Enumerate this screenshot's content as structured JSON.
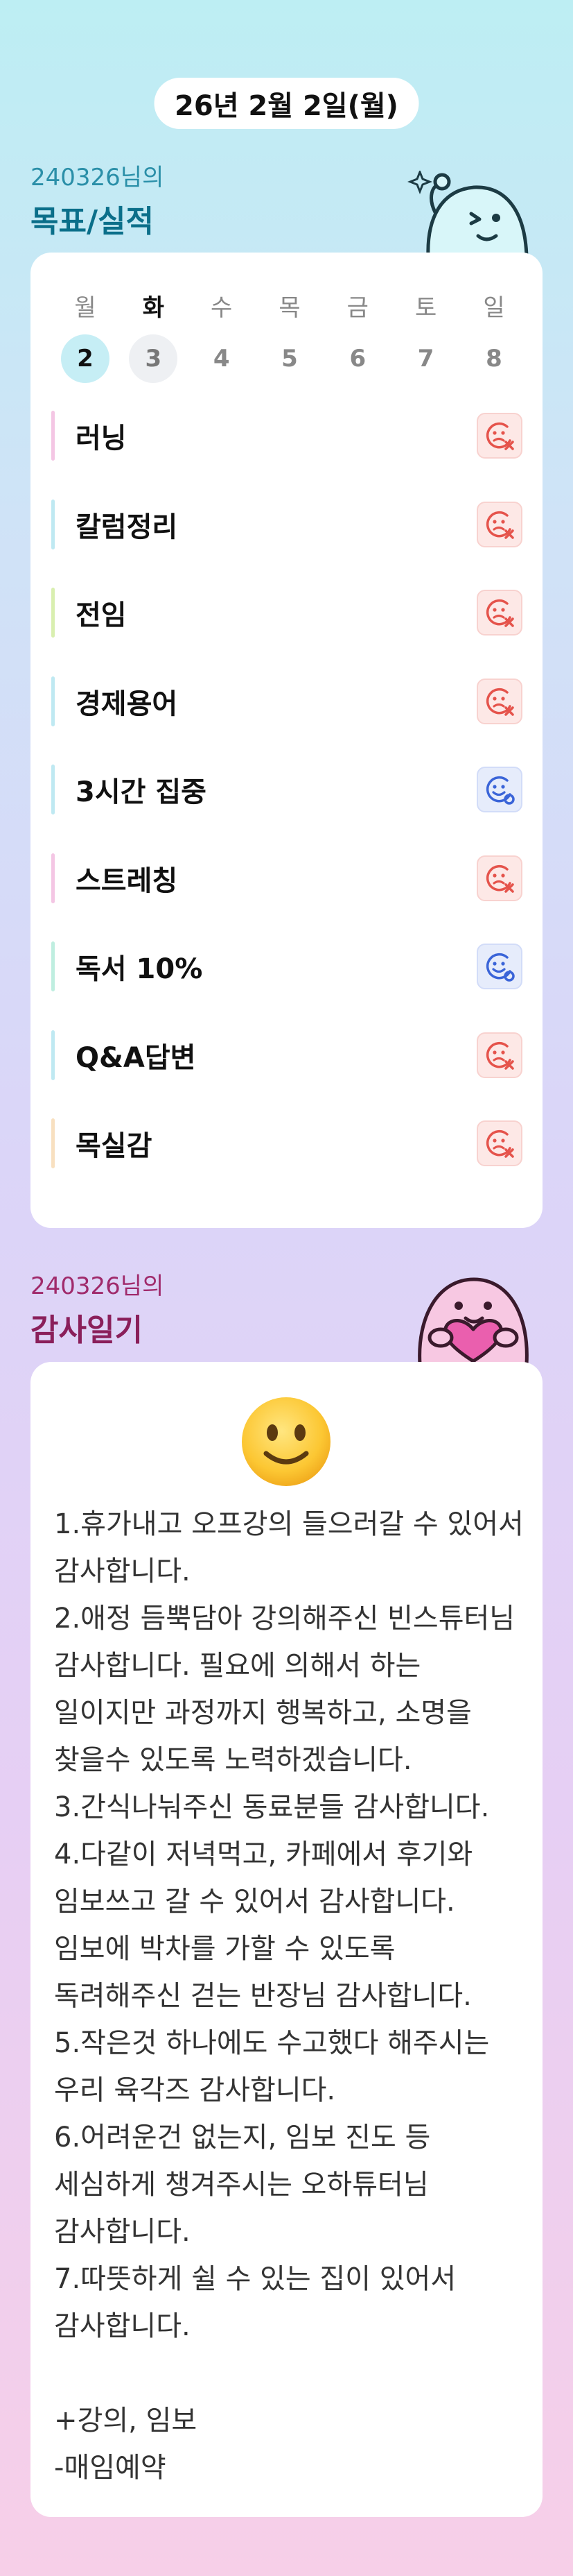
{
  "header": {
    "date": "26년 2월 2일(월)"
  },
  "goals_section": {
    "subtitle": "240326님의",
    "title": "목표/실적"
  },
  "week": {
    "days": [
      {
        "name": "월",
        "num": "2",
        "state": "selected"
      },
      {
        "name": "화",
        "num": "3",
        "state": "today"
      },
      {
        "name": "수",
        "num": "4",
        "state": "normal"
      },
      {
        "name": "목",
        "num": "5",
        "state": "normal"
      },
      {
        "name": "금",
        "num": "6",
        "state": "normal"
      },
      {
        "name": "토",
        "num": "7",
        "state": "normal"
      },
      {
        "name": "일",
        "num": "8",
        "state": "normal"
      }
    ]
  },
  "goals": [
    {
      "label": "러닝",
      "status": "fail",
      "bar_color": "#f4c6e4"
    },
    {
      "label": "칼럼정리",
      "status": "fail",
      "bar_color": "#bfe9f2"
    },
    {
      "label": "전임",
      "status": "fail",
      "bar_color": "#d9efb0"
    },
    {
      "label": "경제용어",
      "status": "fail",
      "bar_color": "#bfe9f2"
    },
    {
      "label": "3시간 집중",
      "status": "success",
      "bar_color": "#bfe9f2"
    },
    {
      "label": "스트레칭",
      "status": "fail",
      "bar_color": "#f4c6e4"
    },
    {
      "label": "독서 10%",
      "status": "success",
      "bar_color": "#bfeee0"
    },
    {
      "label": "Q&A답변",
      "status": "fail",
      "bar_color": "#bfe9f2"
    },
    {
      "label": "목실감",
      "status": "fail",
      "bar_color": "#f8e0c0"
    }
  ],
  "colors": {
    "fail_icon": "#e5534b",
    "success_icon": "#3a64d8",
    "accent_teal": "#0b6f8a",
    "accent_plum": "#8a1f5a"
  },
  "thanks_section": {
    "subtitle": "240326님의",
    "title": "감사일기",
    "mood_icon": "slightly-smiling-face-icon",
    "entry": "1.휴가내고 오프강의 들으러갈 수 있어서 감사합니다.\n2.애정 듬뿍담아 강의해주신 빈스튜터님 감사합니다. 필요에 의해서 하는 일이지만 과정까지 행복하고, 소명을 찾을수 있도록 노력하겠습니다.\n3.간식나눠주신 동료분들 감사합니다.\n4.다같이 저녁먹고, 카페에서 후기와 임보쓰고 갈 수 있어서 감사합니다. 임보에 박차를 가할 수 있도록 독려해주신 걷는 반장님 감사합니다.\n5.작은것 하나에도 수고했다 해주시는 우리 육각즈 감사합니다.\n6.어려운건 없는지, 임보 진도 등 세심하게 챙겨주시는 오하튜터님 감사합니다.\n7.따뜻하게 쉴 수 있는 집이 있어서 감사합니다.\n\n+강의, 임보\n-매임예약"
  }
}
